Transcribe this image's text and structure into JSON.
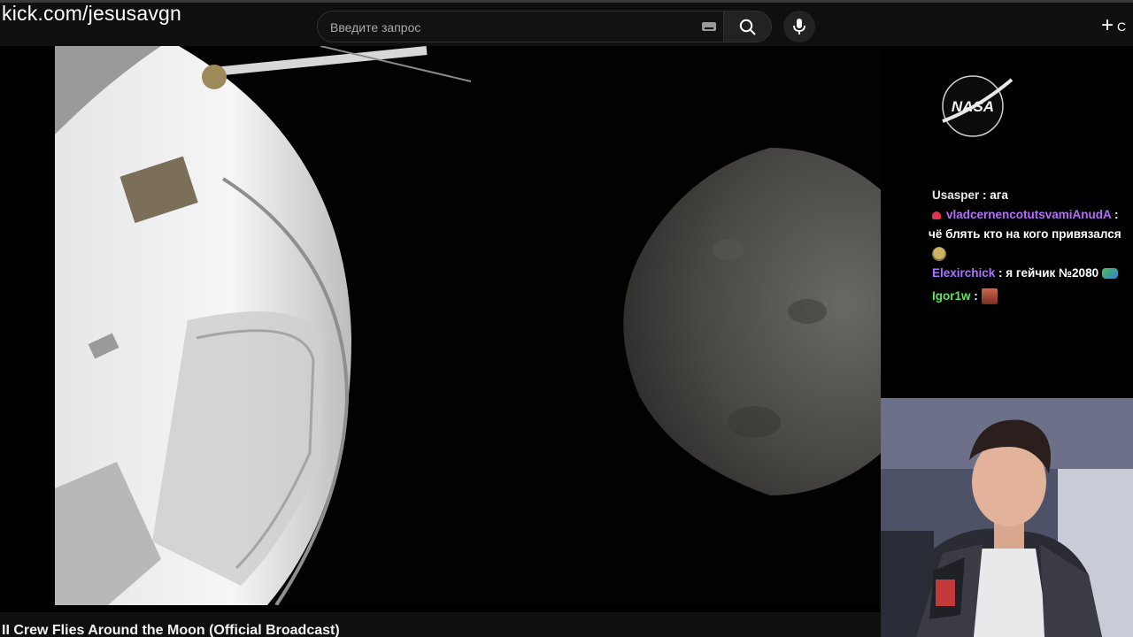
{
  "watermark": "kick.com/jesusavgn",
  "search": {
    "placeholder": "Введите запрос",
    "button_icon": "search-icon",
    "mic_icon": "mic-icon",
    "keyboard_icon": "keyboard-icon"
  },
  "header": {
    "create_icon": "plus-icon",
    "create_label": "С"
  },
  "video": {
    "title": "II Crew Flies Around the Moon (Official Broadcast)"
  },
  "overlay": {
    "logo_text": "NASA"
  },
  "chat": {
    "messages": [
      {
        "user": "Usasper",
        "sep": " : ",
        "text": "ага"
      },
      {
        "user": "vladcernencotutsvamiAnudA",
        "sep": " :",
        "text": "чё блять кто на кого привязался"
      },
      {
        "user": "Elexirchick",
        "sep": " : ",
        "text": "я гейчик №2080"
      },
      {
        "user": "Igor1w",
        "sep": " : ",
        "text": ""
      }
    ]
  },
  "colors": {
    "background": "#0f0f0f",
    "chat_user_purple": "#b86bff",
    "chat_user_green": "#5fe35f"
  }
}
